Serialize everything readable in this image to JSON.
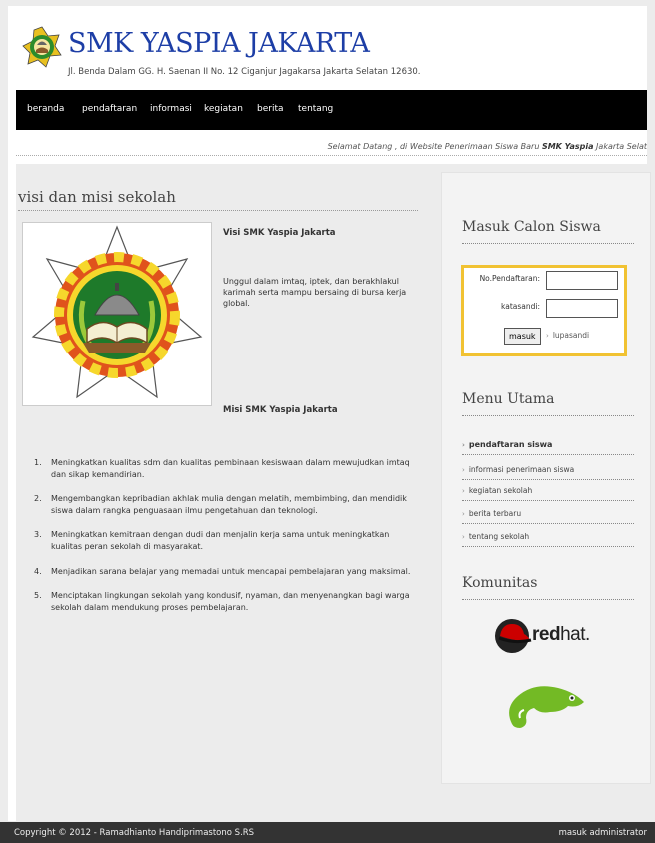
{
  "header": {
    "site_title": "SMK YASPIA JAKARTA",
    "address": "Jl. Benda Dalam GG. H. Saenan II No. 12 Ciganjur Jagakarsa Jakarta Selatan 12630.",
    "logo_icon": "school-logo-icon"
  },
  "nav": {
    "items": [
      {
        "label": "beranda"
      },
      {
        "label": "pendaftaran"
      },
      {
        "label": "informasi"
      },
      {
        "label": "kegiatan"
      },
      {
        "label": "berita"
      },
      {
        "label": "tentang"
      }
    ]
  },
  "marquee": {
    "text_before": "Selamat Datang , di Website Penerimaan Siswa Baru ",
    "brand": "SMK Yaspia",
    "text_after": " Jakarta Selat"
  },
  "main": {
    "heading": "visi dan misi sekolah",
    "vision_title": "Visi SMK Yaspia Jakarta",
    "vision_text": "Unggul dalam imtaq, iptek, dan berakhlakul karimah serta mampu bersaing di bursa kerja global.",
    "mission_title": "Misi SMK Yaspia Jakarta",
    "missions": [
      {
        "num": "1.",
        "text": "Meningkatkan kualitas sdm dan kualitas pembinaan kesiswaan dalam mewujudkan imtaq dan sikap kemandirian."
      },
      {
        "num": "2.",
        "text": "Mengembangkan kepribadian akhlak mulia dengan melatih, membimbing, dan mendidik siswa dalam rangka penguasaan ilmu pengetahuan dan teknologi."
      },
      {
        "num": "3.",
        "text": "Meningkatkan kemitraan dengan dudi dan menjalin kerja sama untuk meningkatkan kualitas peran sekolah di masyarakat."
      },
      {
        "num": "4.",
        "text": "Menjadikan sarana belajar yang memadai untuk mencapai pembelajaran yang maksimal."
      },
      {
        "num": "5.",
        "text": "Menciptakan lingkungan sekolah yang kondusif, nyaman, dan menyenangkan bagi warga sekolah dalam mendukung proses pembelajaran."
      }
    ]
  },
  "sidebar": {
    "login_heading": "Masuk Calon Siswa",
    "login": {
      "registration_label": "No.Pendaftaran:",
      "registration_value": "",
      "password_label": "katasandi:",
      "password_value": "",
      "submit_label": "masuk",
      "forgot_label": "lupasandi"
    },
    "menu_heading": "Menu Utama",
    "menu_items": [
      {
        "label": "pendaftaran siswa"
      },
      {
        "label": "informasi penerimaan siswa"
      },
      {
        "label": "kegiatan sekolah"
      },
      {
        "label": "berita terbaru"
      },
      {
        "label": "tentang sekolah"
      }
    ],
    "community_heading": "Komunitas",
    "redhat": {
      "bold": "red",
      "light": "hat."
    }
  },
  "footer": {
    "copyright": "Copyright © 2012 - Ramadhianto Handiprimastono S.RS",
    "admin_link": "masuk administrator"
  },
  "colors": {
    "title_blue": "#1d3ea6",
    "nav_black": "#000000",
    "login_border": "#f1c232",
    "footer_bg": "#333333"
  }
}
